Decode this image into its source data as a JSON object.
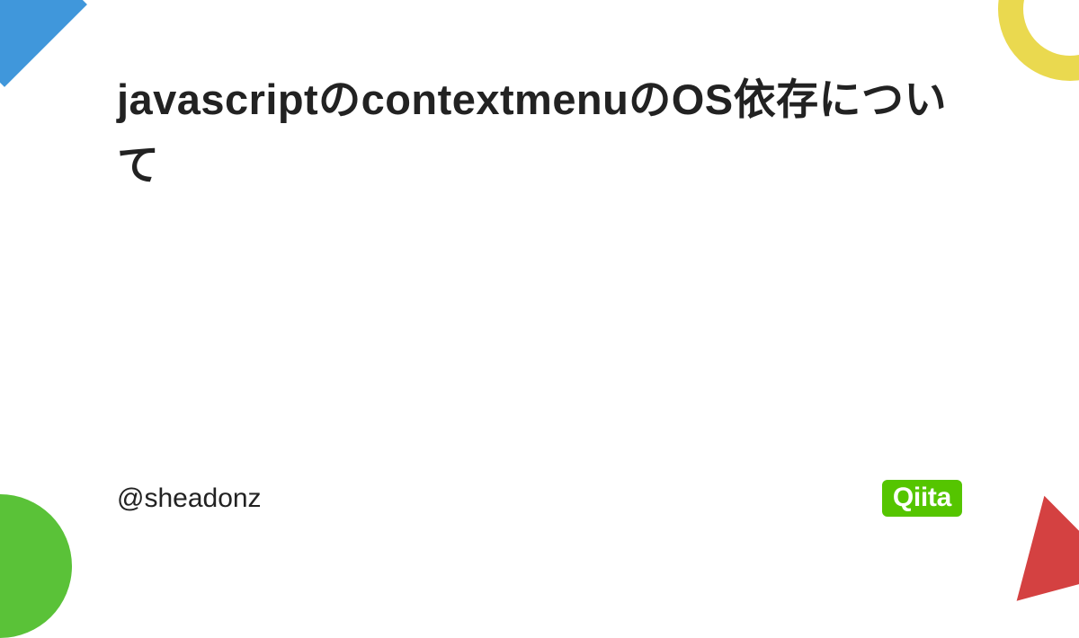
{
  "title": "javascriptのcontextmenuのOS依存について",
  "author": "@sheadonz",
  "logo": "Qiita",
  "colors": {
    "topLeft": "#4097db",
    "topRight": "#ead94f",
    "bottomLeft": "#5ac238",
    "bottomRight": "#d44141",
    "logoBackground": "#55c500"
  }
}
